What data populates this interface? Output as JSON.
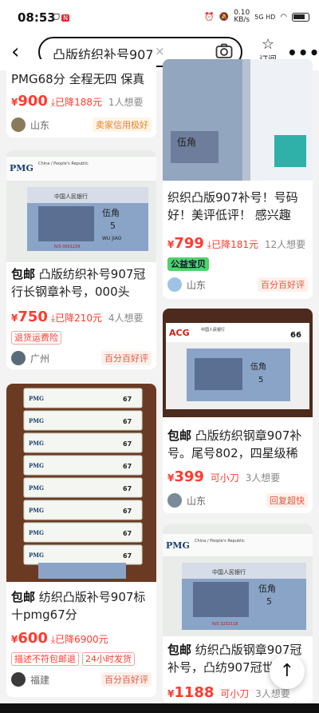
{
  "status": {
    "time": "08:53",
    "left_icons": "ᗜ",
    "pill": "N",
    "net_speed": "0.10",
    "net_unit": "KB/s",
    "net_type": "5G HD"
  },
  "search": {
    "query": "凸版纺织补号907",
    "back_icon": "‹",
    "clear_icon": "×",
    "camera_icon": "camera-icon",
    "subscribe_icon": "☆",
    "subscribe_label": "订阅",
    "more_icon": "•••"
  },
  "cards": [
    {
      "title": "PMG68分 全程无四 保真",
      "price_symbol": "¥",
      "price": "900",
      "drop": "已降188元",
      "want": "1人想要",
      "location": "山东",
      "credit": "卖家信用极好"
    },
    {
      "title": "织织凸版907补号！号码好！美评低评！ 感兴趣",
      "price_symbol": "¥",
      "price": "799",
      "drop": "已降181元",
      "want": "12人想要",
      "badge": "公益宝贝",
      "location": "山东",
      "credit": "百分百好评"
    },
    {
      "baoyou": "包邮",
      "title": "凸版纺织补号907冠行长钢章补号，000头",
      "price_symbol": "¥",
      "price": "750",
      "drop": "已降210元",
      "want": "4人想要",
      "badge": "退货运费险",
      "location": "广州",
      "credit": "百分百好评"
    },
    {
      "baoyou": "包邮",
      "title": "凸版纺织钢章907补号。尾号802，四星级稀",
      "price_symbol": "¥",
      "price": "399",
      "drop": "可小刀",
      "want": "3人想要",
      "location": "山东",
      "credit": "回复超快"
    },
    {
      "baoyou": "包邮",
      "title": "纺织凸版补号907标十pmg67分",
      "price_symbol": "¥",
      "price": "600",
      "drop": "已降6900元",
      "want": "",
      "badges": [
        "描述不符包邮退",
        "24小时发货"
      ],
      "location": "福建",
      "credit": "百分百好评"
    },
    {
      "baoyou": "包邮",
      "title": "纺织凸版钢章907冠补号，凸纺907冠世",
      "price_symbol": "¥",
      "price": "1188",
      "drop": "可小刀",
      "want": "3人想要"
    }
  ],
  "banknote": {
    "cn": "中国人民银行",
    "denom": "伍角",
    "num": "5",
    "en": "WU JIAO",
    "grade_pmg": "PMG",
    "grade_67": "67",
    "grade_66": "66",
    "acg": "ACG",
    "pmg_sub": "China / People's Republic",
    "serial1": "N/S 0001229",
    "serial2": "N/S 3232118"
  },
  "colors": {
    "accent": "#ff3b30",
    "credit": "#e6862a",
    "green_badge": "#4fd26c"
  }
}
